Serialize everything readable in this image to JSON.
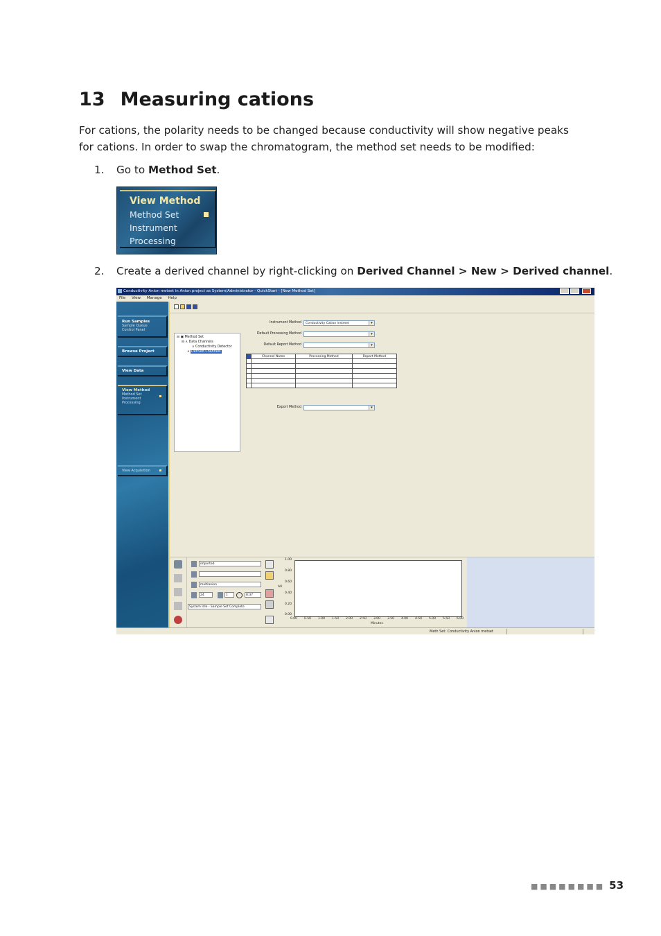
{
  "heading": {
    "number": "13",
    "title": "Measuring cations"
  },
  "intro": "For cations, the polarity needs to be changed because conductivity will show negative peaks for cations. In order to swap the chromatogram, the method set needs to be modified:",
  "steps": [
    {
      "num": "1.",
      "pre": "Go to ",
      "bold": "Method Set",
      "post": "."
    },
    {
      "num": "2.",
      "pre": "Create a derived channel by right-clicking on ",
      "bold": "Derived Channel > New > Derived channel",
      "post": "."
    }
  ],
  "menu_shot": {
    "header": "View Method",
    "items": [
      "Method Set",
      "Instrument",
      "Processing"
    ]
  },
  "app": {
    "title": "Conductivity Anion metset in Anion project as System/Administrator - QuickStart - [New Method Set]",
    "menubar": [
      "File",
      "View",
      "Manage",
      "Help"
    ],
    "nav": {
      "run": {
        "header": "Run Samples",
        "items": [
          "Sample Queue",
          "Control Panel"
        ]
      },
      "browse": "Browse Project",
      "viewdata": "View Data",
      "viewmethod": {
        "header": "View Method",
        "items": [
          "Method Set",
          "Instrument",
          "Processing"
        ]
      },
      "acq": "View Acquisition"
    },
    "tree": {
      "root": "Method Set",
      "data_channels": "Data Channels",
      "detector": "Conductivity Detector",
      "derived": "Derived Channels"
    },
    "form": {
      "instrument_method_label": "Instrument Method",
      "instrument_method_value": "Conductivity Cation instmet",
      "default_processing_label": "Default Processing Method",
      "default_report_label": "Default Report Method",
      "export_label": "Export Method"
    },
    "table_headers": [
      "Channel Name",
      "Processing Method",
      "Report Method"
    ],
    "bottom": {
      "field1": "imported",
      "field3": "multianion",
      "num1": "24",
      "num2": "1",
      "num3": "8:37",
      "status": "System Idle - Sample Set Complete"
    },
    "plot": {
      "ylabel": "AU",
      "xlabel": "Minutes",
      "yticks": [
        "1.00",
        "0.80",
        "0.60",
        "0.40",
        "0.20",
        "0.00"
      ],
      "xticks": [
        "0.00",
        "0.50",
        "1.00",
        "1.50",
        "2.00",
        "2.50",
        "3.00",
        "3.50",
        "4.00",
        "4.50",
        "5.00",
        "5.50",
        "6.00"
      ]
    },
    "statusbar": "Meth Set: Conductivity Anion metset"
  },
  "footer": {
    "page": "53"
  }
}
